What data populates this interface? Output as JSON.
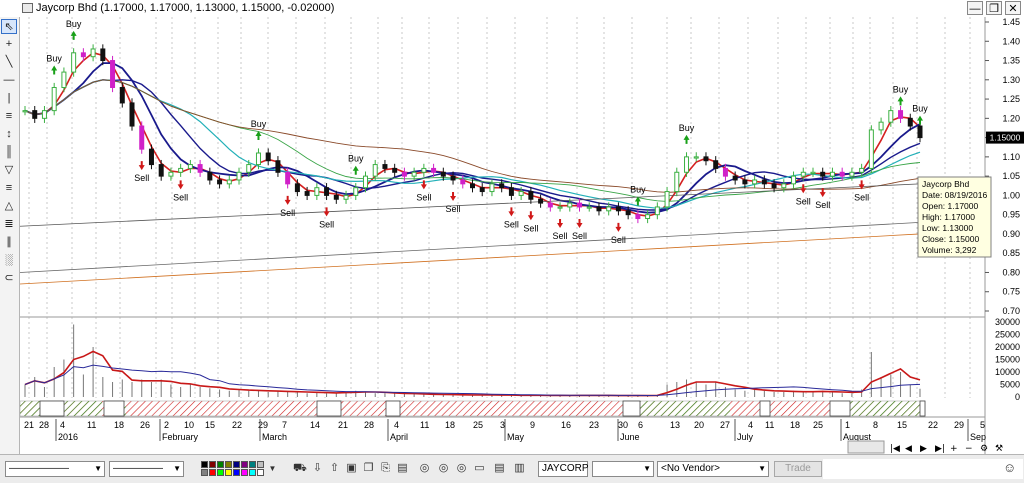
{
  "window": {
    "title": "Jaycorp Bhd (1.17000, 1.17000, 1.13000, 1.15000, -0.02000)",
    "minimize": "—",
    "restore": "❐",
    "close": "✕"
  },
  "left_toolbar": [
    "cursor-icon",
    "crosshair-icon",
    "trendline-icon",
    "horizontal-line-icon",
    "vertical-line-icon",
    "fibonacci-icon",
    "zoom-fit-icon",
    "channel-icon",
    "fan-icon",
    "cycle-icon",
    "triangle-icon",
    "pitchfork-icon",
    "bars-icon",
    "gann-icon",
    "arc-icon"
  ],
  "price_axis": {
    "ticks": [
      "1.45",
      "1.40",
      "1.35",
      "1.30",
      "1.25",
      "1.20",
      "1.15",
      "1.10",
      "1.05",
      "1.00",
      "0.95",
      "0.90",
      "0.85",
      "0.80",
      "0.75",
      "0.70"
    ],
    "last_price": "1.15000"
  },
  "volume_axis": {
    "ticks": [
      "30000",
      "25000",
      "20000",
      "15000",
      "10000",
      "5000",
      "0"
    ]
  },
  "time_axis": {
    "days": [
      "21",
      "28",
      "4",
      "11",
      "18",
      "26",
      "2",
      "10",
      "15",
      "22",
      "29",
      "7",
      "14",
      "21",
      "28",
      "4",
      "11",
      "18",
      "25",
      "3",
      "9",
      "16",
      "23",
      "30",
      "6",
      "13",
      "20",
      "27",
      "4",
      "11",
      "18",
      "25",
      "1",
      "8",
      "15",
      "22",
      "29",
      "5"
    ],
    "months": [
      "2016",
      "February",
      "March",
      "April",
      "May",
      "June",
      "July",
      "August",
      "Sep"
    ]
  },
  "signals": {
    "buy_label": "Buy",
    "sell_label": "Sell"
  },
  "tooltip": {
    "name": "Jaycorp Bhd",
    "date": "Date: 08/19/2016",
    "open": "Open: 1.17000",
    "high": "High: 1.17000",
    "low": "Low: 1.13000",
    "close": "Close: 1.15000",
    "volume": "Volume: 3,292"
  },
  "bottom_toolbar": {
    "line_style_1": "——————",
    "line_style_2": "—————",
    "symbol": "JAYCORP",
    "vendor": "<No Vendor>",
    "trade": "Trade"
  },
  "chart_data": {
    "type": "candlestick",
    "ylim": [
      0.7,
      1.45
    ],
    "volume_ylim": [
      0,
      30000
    ],
    "x_range": [
      "2016-01-21",
      "2016-08-29"
    ],
    "close": [
      1.22,
      1.2,
      1.22,
      1.28,
      1.32,
      1.37,
      1.36,
      1.38,
      1.35,
      1.28,
      1.24,
      1.18,
      1.12,
      1.08,
      1.05,
      1.06,
      1.07,
      1.08,
      1.06,
      1.04,
      1.03,
      1.04,
      1.06,
      1.08,
      1.11,
      1.09,
      1.06,
      1.03,
      1.01,
      1.0,
      1.02,
      1.0,
      0.99,
      1.0,
      1.02,
      1.05,
      1.08,
      1.07,
      1.06,
      1.05,
      1.06,
      1.07,
      1.06,
      1.05,
      1.04,
      1.03,
      1.02,
      1.01,
      1.03,
      1.02,
      1.0,
      1.01,
      0.99,
      0.98,
      0.97,
      0.97,
      0.98,
      0.97,
      0.97,
      0.96,
      0.97,
      0.96,
      0.95,
      0.94,
      0.95,
      0.97,
      1.01,
      1.06,
      1.1,
      1.1,
      1.09,
      1.07,
      1.05,
      1.04,
      1.03,
      1.04,
      1.03,
      1.02,
      1.03,
      1.05,
      1.06,
      1.06,
      1.05,
      1.06,
      1.05,
      1.06,
      1.07,
      1.17,
      1.19,
      1.22,
      1.2,
      1.18,
      1.15
    ],
    "volume": [
      5000,
      8000,
      4000,
      12000,
      15000,
      29000,
      9000,
      20000,
      8000,
      6000,
      7000,
      6000,
      7000,
      6000,
      7000,
      5000,
      4000,
      5000,
      4000,
      3500,
      3000,
      2500,
      3000,
      2500,
      2500,
      2000,
      2500,
      2000,
      2000,
      1500,
      2000,
      1500,
      1500,
      2000,
      2500,
      2000,
      1500,
      1500,
      1500,
      1200,
      1200,
      1000,
      1000,
      800,
      1000,
      800,
      800,
      800,
      800,
      600,
      800,
      600,
      700,
      600,
      600,
      600,
      600,
      800,
      600,
      600,
      600,
      500,
      600,
      600,
      600,
      800,
      5000,
      6000,
      7000,
      6000,
      5000,
      6000,
      4000,
      3000,
      2500,
      3000,
      2500,
      2000,
      2000,
      2500,
      2000,
      2000,
      2500,
      2000,
      1500,
      1500,
      3000,
      18000,
      8000,
      9000,
      10000,
      5000,
      3292
    ],
    "buy_signals": [
      "Buy",
      "Buy",
      "Buy",
      "Buy",
      "Buy",
      "Buy",
      "Buy",
      "Buy"
    ],
    "sell_signals": [
      "Sell",
      "Sell",
      "Sell",
      "Sell",
      "Sell",
      "Sell",
      "Sell",
      "Sell",
      "Sell",
      "Sell",
      "Sell",
      "Sell",
      "Sell",
      "Sell"
    ]
  }
}
